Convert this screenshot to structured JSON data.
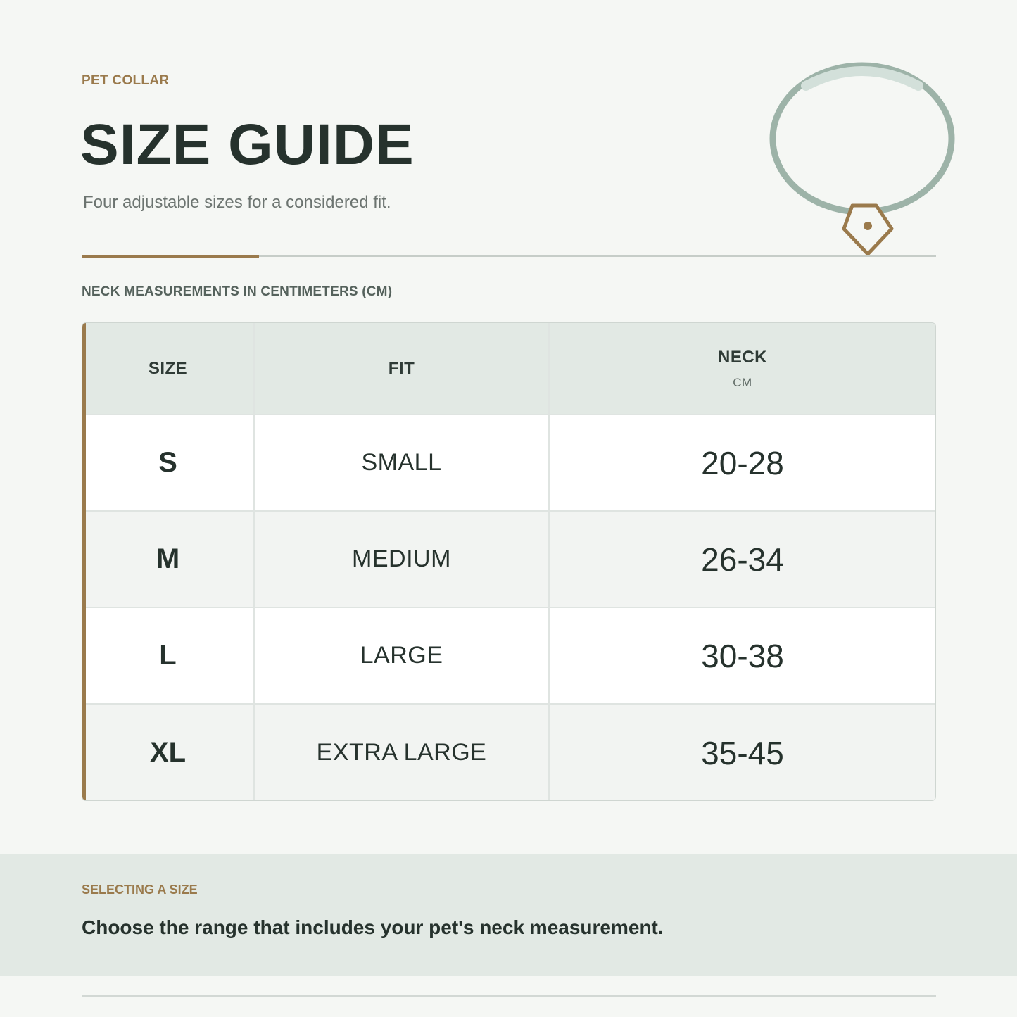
{
  "header": {
    "eyebrow": "PET COLLAR",
    "title": "SIZE GUIDE",
    "subtitle": "Four adjustable sizes for a considered fit."
  },
  "table_caption": "NECK MEASUREMENTS IN CENTIMETERS (CM)",
  "table": {
    "headers": {
      "size": "SIZE",
      "fit": "FIT",
      "neck": "NECK",
      "neck_unit": "CM"
    },
    "rows": [
      {
        "size": "S",
        "fit": "SMALL",
        "neck": "20-28"
      },
      {
        "size": "M",
        "fit": "MEDIUM",
        "neck": "26-34"
      },
      {
        "size": "L",
        "fit": "LARGE",
        "neck": "30-38"
      },
      {
        "size": "XL",
        "fit": "EXTRA LARGE",
        "neck": "35-45"
      }
    ]
  },
  "note": {
    "label": "SELECTING A SIZE",
    "text": "Choose the range that includes your pet's neck measurement."
  },
  "icons": {
    "collar": "collar-icon"
  },
  "colors": {
    "accent": "#9a7a4c",
    "text": "#26322d",
    "collar_band": "#9db3a8",
    "header_bg": "#e2e9e4"
  }
}
